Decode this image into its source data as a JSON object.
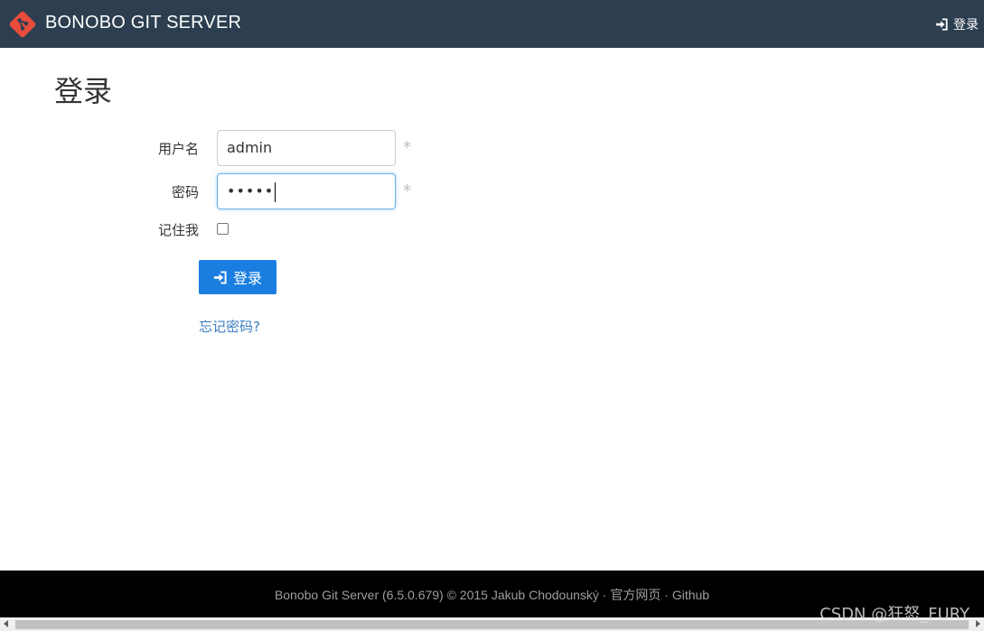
{
  "header": {
    "brand": "BONOBO GIT SERVER",
    "login_link": "登录"
  },
  "page": {
    "title": "登录"
  },
  "form": {
    "username_label": "用户名",
    "username_value": "admin",
    "password_label": "密码",
    "password_value": "•••••",
    "required_mark": "*",
    "remember_label": "记住我",
    "remember_checked": false,
    "submit_label": "登录",
    "forgot_link": "忘记密码?"
  },
  "footer": {
    "text": "Bonobo Git Server (6.5.0.679) © 2015 Jakub Chodounský ·",
    "link_official": "官方网页",
    "separator": "·",
    "link_github": "Github"
  },
  "watermark": "CSDN @狂怒_FURY",
  "icons": {
    "logo": "git-diamond-logo-icon",
    "login": "sign-in-icon"
  },
  "colors": {
    "header_bg": "#2c3e50",
    "primary_button": "#1a7ee0",
    "link": "#3c7fc2",
    "footer_bg": "#000000",
    "logo": "#e74c3c"
  }
}
